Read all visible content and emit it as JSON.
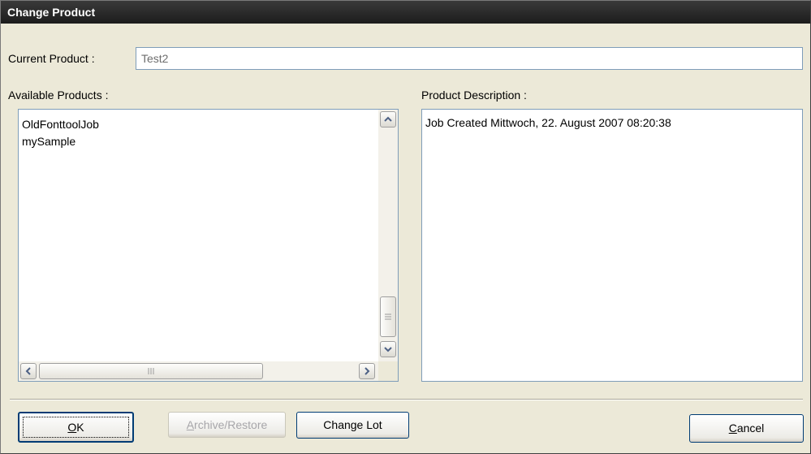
{
  "window": {
    "title": "Change Product"
  },
  "current_product": {
    "label": "Current Product :",
    "value": "Test2"
  },
  "available_products": {
    "label": "Available Products :",
    "items": [
      "OldFonttoolJob",
      "mySample"
    ]
  },
  "product_description": {
    "label": "Product Description :",
    "text": "Job Created Mittwoch, 22. August 2007 08:20:38"
  },
  "buttons": {
    "ok": {
      "accel": "O",
      "rest": "K"
    },
    "archive_restore": {
      "accel": "A",
      "rest": "rchive/Restore",
      "enabled": false
    },
    "change_lot": "Change Lot",
    "cancel": {
      "accel": "C",
      "rest": "ancel"
    }
  },
  "icons": {
    "scroll_up": "chevron-up-icon",
    "scroll_down": "chevron-down-icon",
    "scroll_left": "chevron-left-icon",
    "scroll_right": "chevron-right-icon",
    "grip": "scrollbar-grip-icon"
  },
  "colors": {
    "dialog_bg": "#ece9d8",
    "titlebar": "#1c1c1c",
    "field_border": "#7f9db9",
    "button_border": "#003c74",
    "disabled_text": "#a7a6aa",
    "current_value_text": "#6d6d6d"
  }
}
